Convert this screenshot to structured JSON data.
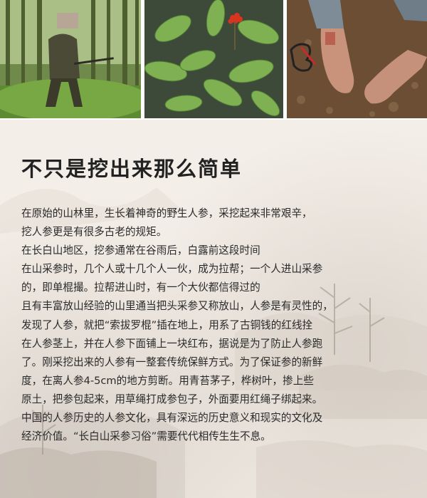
{
  "photos": [
    {
      "subject": "person-in-forest",
      "icon": "forest-photo"
    },
    {
      "subject": "ginseng-plant",
      "icon": "plant-photo"
    },
    {
      "subject": "hands-digging",
      "icon": "hands-photo"
    }
  ],
  "article": {
    "title": "不只是挖出来那么简单",
    "lines": [
      "在原始的山林里，生长着神奇的野生人参，采挖起来非常艰辛，",
      "挖人参更是有很多古老的规矩。",
      "在长白山地区，挖参通常在谷雨后，白露前这段时间",
      "在山采参时，几个人或十几个人一伙，成为拉帮；一个人进山采参",
      "的，即单棍撮。拉帮进山时，有一个大伙都信得过的",
      "且有丰富放山经验的山里通当把头采参又称放山，人参是有灵性的，",
      "发现了人参，就把“索拔罗棍”插在地上，用系了古铜钱的红线拴",
      "在人参茎上，并在人参下面铺上一块红布，据说是为了防止人参跑",
      "了。刚采挖出来的人参有一整套传统保鲜方式。为了保证参的新鲜",
      "度，在离人参4-5cm的地方剪断。用青苔茅子，桦树叶，掺上些",
      "原土，把参包起来，用草绳打成参包子，外面要用红绳子绑起来。",
      "中国的人参历史的人参文化，具有深远的历史意义和现实的文化及",
      "经济价值。“长白山采参习俗”需要代代相传生生不息。"
    ]
  },
  "colors": {
    "background": "#f3eee8",
    "title": "#222222",
    "text": "#2a2a2a"
  }
}
